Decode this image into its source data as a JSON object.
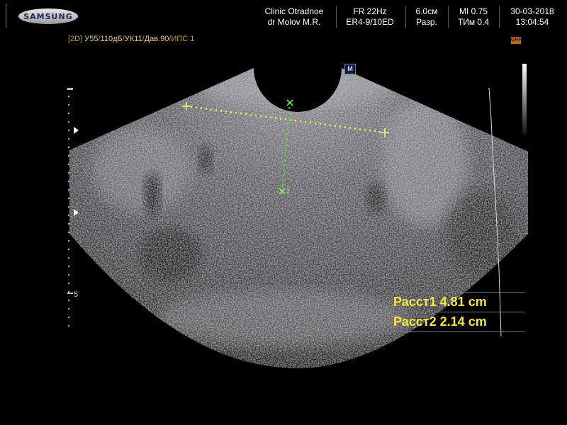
{
  "header": {
    "brand": "SAMSUNG",
    "clinic": "Clinic  Otradnoe",
    "doctor": "dr Molov M.R.",
    "frame_rate": "FR 22Hz",
    "probe": "ER4-9/10ED",
    "depth": "6.0см",
    "resolution": "Разр.",
    "mi": "MI  0.75",
    "tim": "TИм 0.4",
    "date": "30-03-2018",
    "time": "13:04:54"
  },
  "params": {
    "mode": "[2D]",
    "gain": "У55",
    "sep1": "/",
    "dr": "110дБ",
    "sep2": "/",
    "uk": "УК11",
    "sep3": "/",
    "pressure": "Дав.90",
    "sep4": "/",
    "ips": "ИПС 1"
  },
  "grf_badge": "GRF",
  "m_marker": "M",
  "caliper_label": "2",
  "depth_scale_label": "5",
  "measurements": [
    {
      "label": "Расст1",
      "value": "4.81 cm"
    },
    {
      "label": "Расст2",
      "value": "2.14 cm"
    }
  ]
}
